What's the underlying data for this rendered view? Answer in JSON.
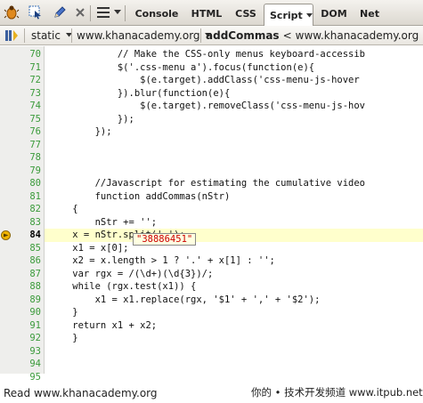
{
  "toolbar": {
    "tabs": [
      {
        "label": "Console",
        "active": false
      },
      {
        "label": "HTML",
        "active": false
      },
      {
        "label": "CSS",
        "active": false
      },
      {
        "label": "Script",
        "active": true
      },
      {
        "label": "DOM",
        "active": false
      },
      {
        "label": "Net",
        "active": false
      }
    ]
  },
  "location": {
    "scope": "static",
    "file": "www.khanacademy.org",
    "function_name": "addCommas",
    "function_sep": "<",
    "function_file": "www.khanacademy.org"
  },
  "editor": {
    "current_line": "84",
    "lines": [
      {
        "n": "70",
        "code": "            // Make the CSS-only menus keyboard-accessib"
      },
      {
        "n": "71",
        "code": "            $('.css-menu a').focus(function(e){"
      },
      {
        "n": "72",
        "code": "                $(e.target).addClass('css-menu-js-hover"
      },
      {
        "n": "73",
        "code": "            }).blur(function(e){"
      },
      {
        "n": "74",
        "code": "                $(e.target).removeClass('css-menu-js-hov"
      },
      {
        "n": "75",
        "code": "            });"
      },
      {
        "n": "76",
        "code": "        });"
      },
      {
        "n": "77",
        "code": ""
      },
      {
        "n": "78",
        "code": ""
      },
      {
        "n": "79",
        "code": ""
      },
      {
        "n": "80",
        "code": "        //Javascript for estimating the cumulative video"
      },
      {
        "n": "81",
        "code": "        function addCommas(nStr)"
      },
      {
        "n": "82",
        "code": "    {"
      },
      {
        "n": "83",
        "code": "        nStr += '';"
      },
      {
        "n": "84",
        "code": "    x = nStr.split('.');"
      },
      {
        "n": "85",
        "code": "    x1 = x[0];"
      },
      {
        "n": "86",
        "code": "    x2 = x.length > 1 ? '.' + x[1] : '';"
      },
      {
        "n": "87",
        "code": "    var rgx = /(\\d+)(\\d{3})/;"
      },
      {
        "n": "88",
        "code": "    while (rgx.test(x1)) {"
      },
      {
        "n": "89",
        "code": "        x1 = x1.replace(rgx, '$1' + ',' + '$2');"
      },
      {
        "n": "90",
        "code": "    }"
      },
      {
        "n": "91",
        "code": "    return x1 + x2;"
      },
      {
        "n": "92",
        "code": "    }"
      },
      {
        "n": "93",
        "code": ""
      },
      {
        "n": "94",
        "code": ""
      },
      {
        "n": "95",
        "code": ""
      }
    ],
    "tooltip_value": "\"38886451\""
  },
  "status": {
    "text": "Read www.khanacademy.org",
    "watermark": "你的 • 技术开发频道 www.itpub.net"
  },
  "colors": {
    "line_number": "#3a9a3a",
    "exec_highlight": "#ffffcc",
    "tooltip_text": "#cc0000"
  }
}
